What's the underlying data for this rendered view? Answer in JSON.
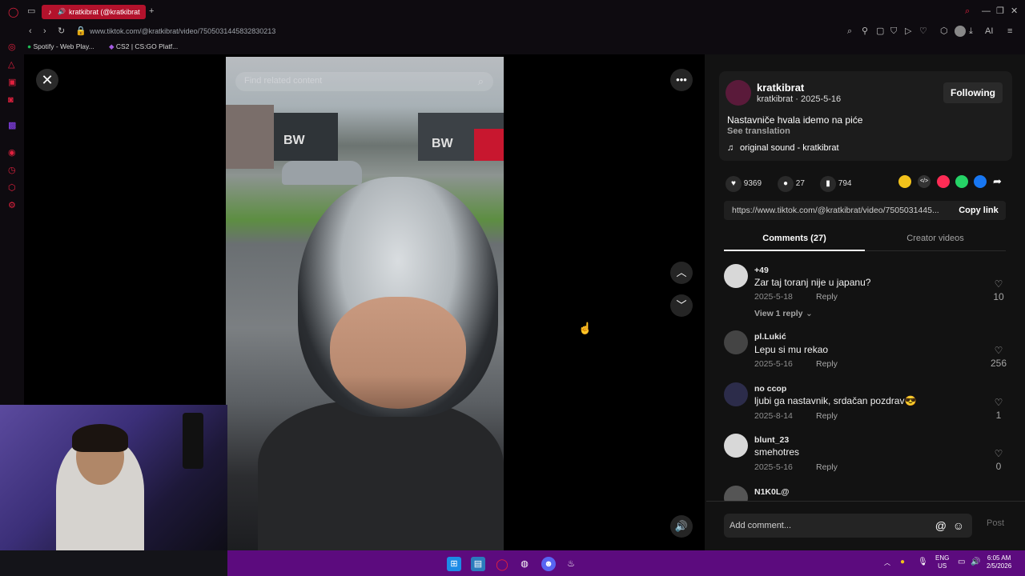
{
  "browser": {
    "tab_title": "kratkibrat (@kratkibrat",
    "url": "www.tiktok.com/@kratkibrat/video/7505031445832830213",
    "bookmarks": [
      "Spotify - Web Play...",
      "CS2 | CS:GO Platf..."
    ]
  },
  "video": {
    "search_placeholder": "Find related content",
    "watermark": "BW"
  },
  "author": {
    "name": "kratkibrat",
    "handle_date": "kratkibrat · 2025-5-16",
    "follow_label": "Following",
    "caption": "Nastavniče hvala idemo na piće",
    "see_translation": "See translation",
    "sound": "original sound - kratkibrat"
  },
  "stats": {
    "likes": "9369",
    "comments": "27",
    "saves": "794"
  },
  "link": {
    "url": "https://www.tiktok.com/@kratkibrat/video/7505031445...",
    "copy_label": "Copy link"
  },
  "tabs": {
    "comments": "Comments (27)",
    "creator": "Creator videos"
  },
  "comments": [
    {
      "user": "+49",
      "text": "Zar taj toranj nije u japanu?",
      "date": "2025-5-18",
      "reply": "Reply",
      "likes": "10",
      "view_replies": "View 1 reply"
    },
    {
      "user": "pl.Lukić",
      "text": "Lepu si mu rekao",
      "date": "2025-5-16",
      "reply": "Reply",
      "likes": "256"
    },
    {
      "user": "no ccop",
      "text": "ljubi ga nastavnik, srdačan pozdrav😎",
      "date": "2025-8-14",
      "reply": "Reply",
      "likes": "1"
    },
    {
      "user": "blunt_23",
      "text": "smehotres",
      "date": "2025-5-16",
      "reply": "Reply",
      "likes": "0"
    },
    {
      "user": "N1K0L@",
      "text": "",
      "date": "",
      "reply": "",
      "likes": ""
    }
  ],
  "composer": {
    "placeholder": "Add comment...",
    "post_label": "Post"
  },
  "taskbar": {
    "lang": "ENG",
    "region": "US",
    "time": "6:05 AM",
    "date": "2/5/2026"
  },
  "colors": {
    "accent_red": "#e0213e",
    "taskbar": "#5c0b7e",
    "panel_bg": "#121212"
  }
}
